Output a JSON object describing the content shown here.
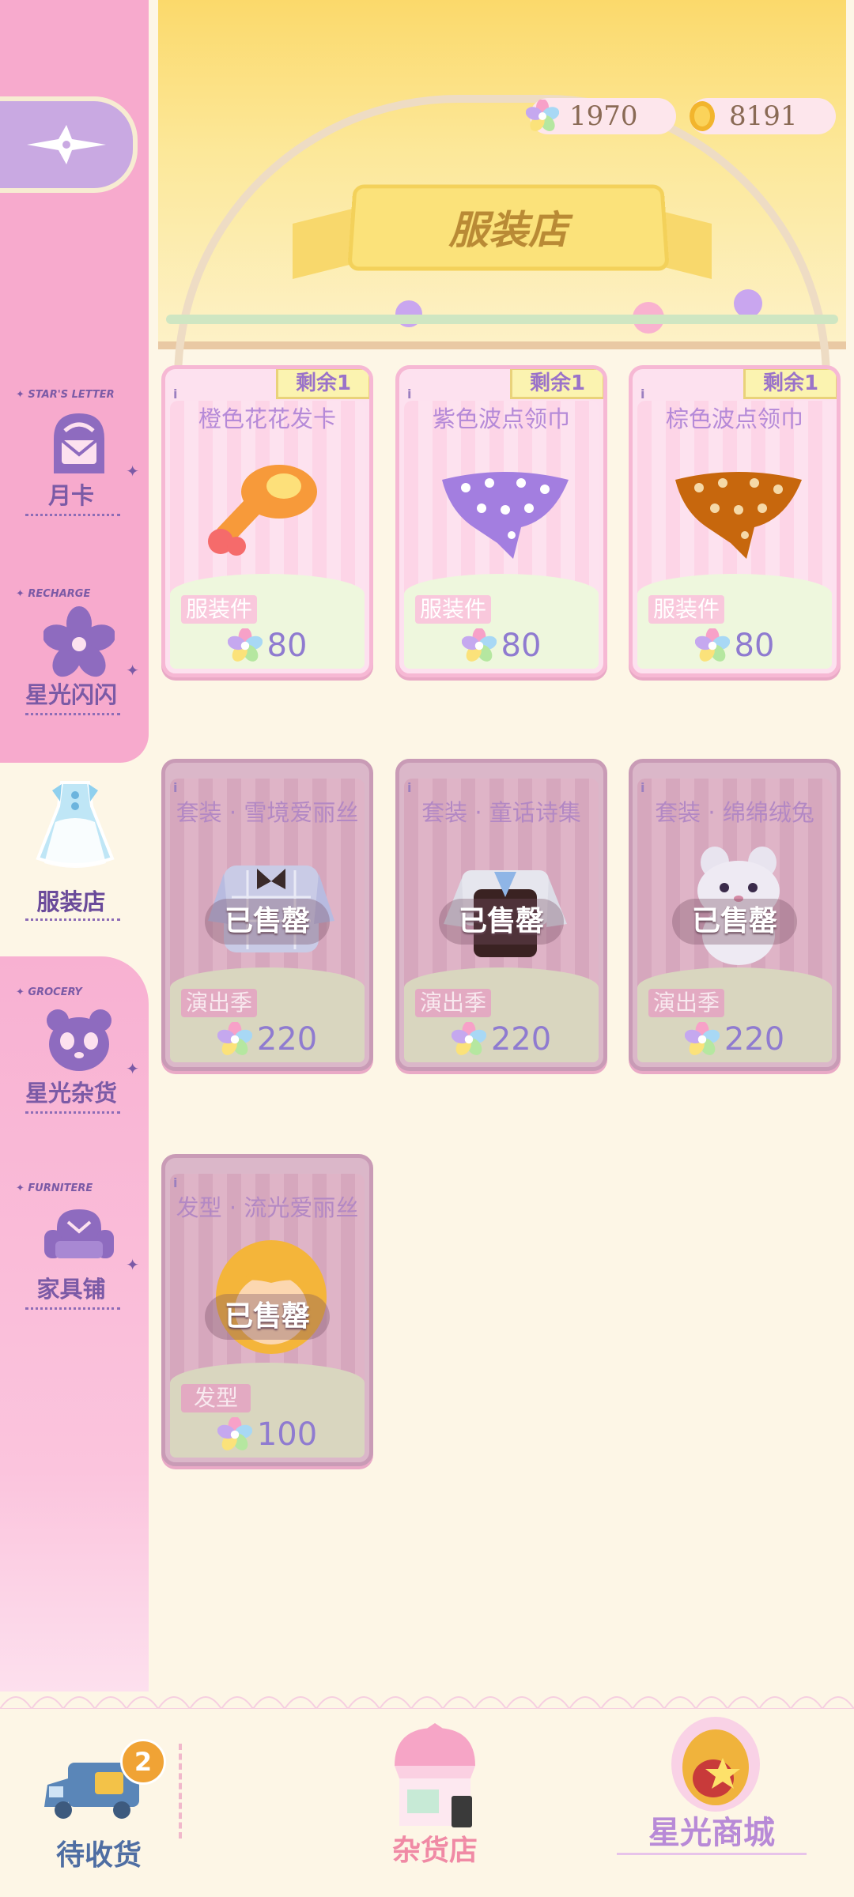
{
  "header": {
    "title": "服装店",
    "currencies": [
      {
        "icon": "star-gem-icon",
        "value": "1970"
      },
      {
        "icon": "gold-coin-icon",
        "value": "8191"
      }
    ]
  },
  "sidebar": {
    "back_icon": "compass-star-icon",
    "items": [
      {
        "tag": "STAR'S LETTER",
        "label": "月卡",
        "icon": "mailbox-icon"
      },
      {
        "tag": "RECHARGE",
        "label": "星光闪闪",
        "icon": "flower-icon"
      },
      {
        "tag": "",
        "label": "服装店",
        "icon": "dress-icon",
        "active": true
      },
      {
        "tag": "GROCERY",
        "label": "星光杂货",
        "icon": "panda-icon"
      },
      {
        "tag": "FURNITERE",
        "label": "家具铺",
        "icon": "armchair-icon"
      }
    ]
  },
  "shop": {
    "remaining_prefix": "剩余",
    "sold_out_label": "已售罄",
    "items": [
      {
        "name": "橙色花花发卡",
        "category": "服装件",
        "price": "80",
        "remaining": "1",
        "sold_out": false,
        "icon": "orange-flower-hairpin-icon",
        "color": "#f79a3a"
      },
      {
        "name": "紫色波点领巾",
        "category": "服装件",
        "price": "80",
        "remaining": "1",
        "sold_out": false,
        "icon": "purple-polka-scarf-icon",
        "color": "#a37ee0"
      },
      {
        "name": "棕色波点领巾",
        "category": "服装件",
        "price": "80",
        "remaining": "1",
        "sold_out": false,
        "icon": "brown-polka-scarf-icon",
        "color": "#c7670d"
      },
      {
        "name": "套装 · 雪境爱丽丝",
        "category": "演出季",
        "price": "220",
        "sold_out": true,
        "icon": "outfit-snow-alice-icon"
      },
      {
        "name": "套装 · 童话诗集",
        "category": "演出季",
        "price": "220",
        "sold_out": true,
        "icon": "outfit-fairytale-icon"
      },
      {
        "name": "套装 · 绵绵绒兔",
        "category": "演出季",
        "price": "220",
        "sold_out": true,
        "icon": "outfit-bunny-icon"
      },
      {
        "name": "发型 · 流光爱丽丝",
        "category": "发型",
        "price": "100",
        "sold_out": true,
        "icon": "hairstyle-alice-icon"
      }
    ]
  },
  "bottom_nav": {
    "pending_delivery": {
      "label": "待收货",
      "count": "2",
      "icon": "delivery-truck-icon"
    },
    "grocery": {
      "label": "杂货店",
      "icon": "grocery-stall-icon"
    },
    "starlight_mall": {
      "label": "星光商城",
      "icon": "starlight-mall-icon"
    }
  },
  "colors": {
    "sidebar_pink": "#f7aacd",
    "accent_purple": "#7b5aa6",
    "header_yellow": "#fbd96b",
    "price_purple": "#8f7bd0"
  }
}
